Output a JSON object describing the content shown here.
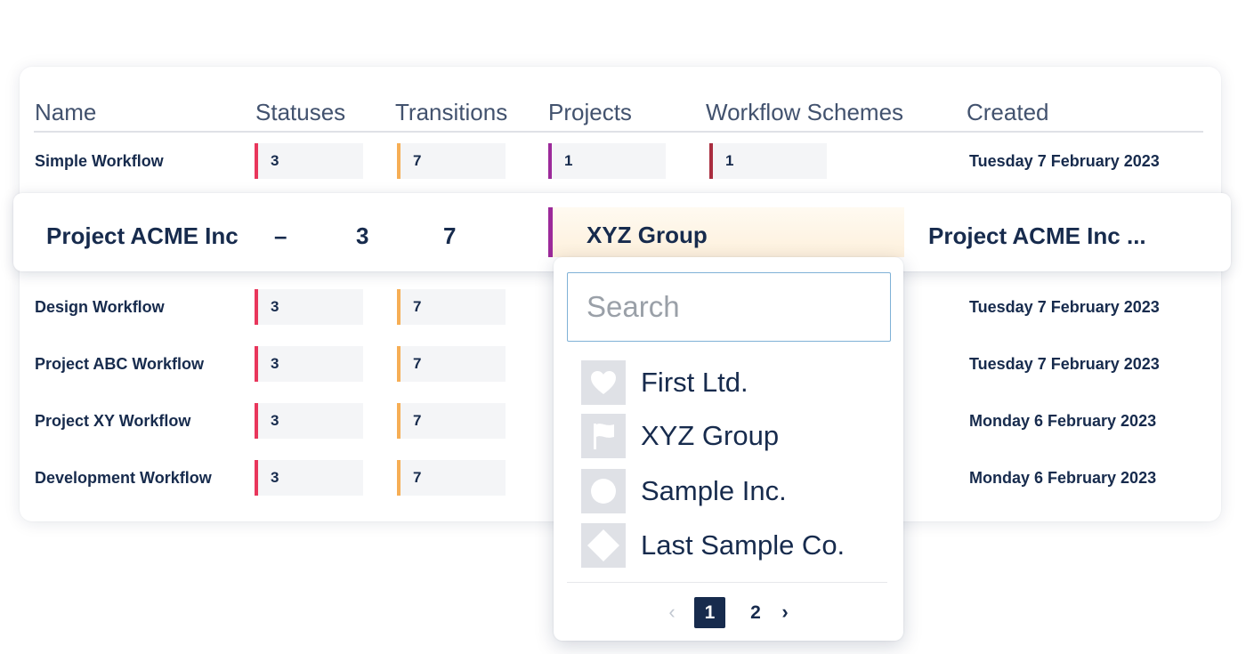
{
  "columns": {
    "name": "Name",
    "statuses": "Statuses",
    "transitions": "Transitions",
    "projects": "Projects",
    "workflow_schemes": "Workflow Schemes",
    "created": "Created"
  },
  "rows": [
    {
      "name": "Simple Workflow",
      "statuses": "3",
      "transitions": "7",
      "projects": "1",
      "schemes": "1",
      "created": "Tuesday 7 February 2023"
    },
    {
      "name": "Design Workflow",
      "statuses": "3",
      "transitions": "7",
      "created": "Tuesday 7 February 2023"
    },
    {
      "name": "Project ABC Workflow",
      "statuses": "3",
      "transitions": "7",
      "created": "Tuesday 7 February 2023"
    },
    {
      "name": "Project XY Workflow",
      "statuses": "3",
      "transitions": "7",
      "created": "Monday 6 February 2023"
    },
    {
      "name": "Development Workflow",
      "statuses": "3",
      "transitions": "7",
      "created": "Monday 6 February 2023"
    }
  ],
  "highlighted_row": {
    "name": "Project ACME Inc",
    "dash": "–",
    "statuses": "3",
    "transitions": "7",
    "project": "XYZ Group",
    "created": "Project ACME Inc ..."
  },
  "dropdown": {
    "search_placeholder": "Search",
    "options": [
      {
        "label": "First Ltd.",
        "icon": "heart-icon"
      },
      {
        "label": "XYZ Group",
        "icon": "flag-icon"
      },
      {
        "label": "Sample Inc.",
        "icon": "circle-icon"
      },
      {
        "label": "Last Sample Co.",
        "icon": "diamond-icon"
      }
    ],
    "pagination": {
      "prev": "‹",
      "current": "1",
      "next_page": "2",
      "next": "›"
    }
  },
  "colors": {
    "statuses": "#e8365b",
    "transitions": "#f6ae55",
    "projects": "#9c2a9a",
    "schemes": "#a92d3f",
    "text": "#172b4d"
  }
}
